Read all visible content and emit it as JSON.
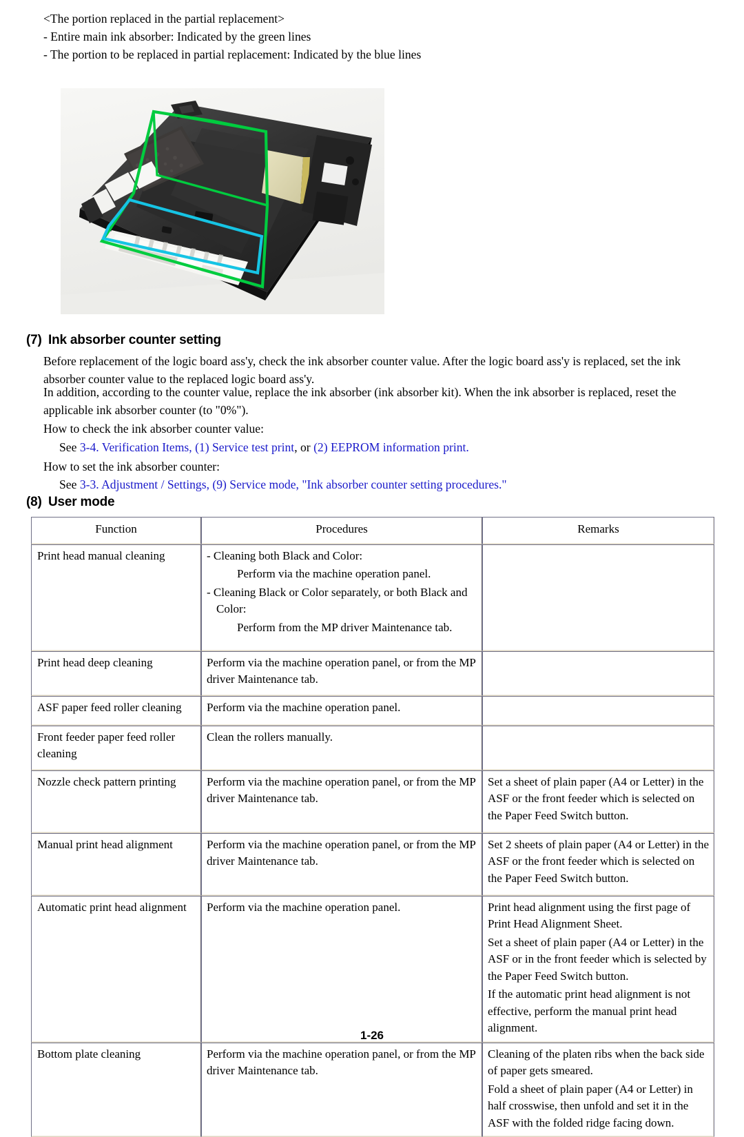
{
  "intro": {
    "title": "<The portion replaced in the partial replacement>",
    "bullet1": "- Entire main ink absorber:  Indicated by the green lines",
    "bullet2": "- The portion to be replaced in partial replacement:  Indicated by the blue lines"
  },
  "photo": {
    "alt": "Printer base frame with main ink absorber areas outlined",
    "green_outline_color": "#00cc3f",
    "blue_outline_color": "#16c4e4",
    "background_color": "#f2f2f0"
  },
  "section7": {
    "number": "(7)",
    "title": "Ink absorber counter setting",
    "para1": "Before replacement of the logic board ass'y, check the ink absorber counter value. After the logic board ass'y is replaced, set the ink absorber counter value to the replaced logic board ass'y.",
    "para2": "In addition, according to the counter value, replace the ink absorber (ink absorber kit). When the ink absorber is replaced, reset the applicable ink absorber counter (to \"0%\").",
    "how_check_label": "How to check the ink absorber counter value:",
    "see1_prefix": "See ",
    "see1_link": "3-4. Verification Items, (1) Service test print",
    "see1_mid": ", or ",
    "see1_link2": "(2) EEPROM information print.",
    "how_set_label": "How to set the ink absorber counter:",
    "see2_prefix": "See ",
    "see2_link": "3-3. Adjustment / Settings, (9) Service mode, \"Ink absorber counter setting procedures.\""
  },
  "section8": {
    "number": "(8)",
    "title": "User mode",
    "table": {
      "headers": [
        "Function",
        "Procedures",
        "Remarks"
      ],
      "rows": [
        {
          "function": "Print head manual cleaning",
          "procedures": [
            {
              "style": "dash",
              "text": "- Cleaning both Black and Color:"
            },
            {
              "style": "ind",
              "text": "Perform via the machine operation panel."
            },
            {
              "style": "dash",
              "text": "- Cleaning Black or Color separately, or both Black and Color:"
            },
            {
              "style": "ind",
              "text": "Perform from the MP driver Maintenance tab."
            }
          ],
          "remarks": []
        },
        {
          "function": "Print head deep cleaning",
          "procedures": [
            {
              "style": "plain",
              "text": "Perform via the machine operation panel, or from the MP driver Maintenance tab."
            }
          ],
          "remarks": []
        },
        {
          "function": "ASF paper feed roller cleaning",
          "procedures": [
            {
              "style": "plain",
              "text": "Perform via the machine operation panel."
            }
          ],
          "remarks": []
        },
        {
          "function": "Front feeder paper feed roller cleaning",
          "procedures": [
            {
              "style": "plain",
              "text": "Clean the rollers manually."
            }
          ],
          "remarks": []
        },
        {
          "function": "Nozzle check pattern printing",
          "procedures": [
            {
              "style": "plain",
              "text": "Perform via the machine operation panel, or from the MP driver Maintenance tab."
            }
          ],
          "remarks": [
            {
              "style": "plain",
              "text": "Set a sheet of plain paper (A4 or Letter) in the ASF or the front feeder which is selected on the Paper Feed Switch button."
            }
          ]
        },
        {
          "function": "Manual print head alignment",
          "procedures": [
            {
              "style": "plain",
              "text": "Perform via the machine operation panel, or from the MP driver Maintenance tab."
            }
          ],
          "remarks": [
            {
              "style": "plain",
              "text": "Set 2 sheets of plain paper (A4 or Letter) in the ASF or the front feeder which is selected on the Paper Feed Switch button."
            }
          ]
        },
        {
          "function": "Automatic print head alignment",
          "procedures": [
            {
              "style": "plain",
              "text": "Perform via the machine operation panel."
            }
          ],
          "remarks": [
            {
              "style": "plain",
              "text": "Print head alignment using the first page of Print Head Alignment Sheet."
            },
            {
              "style": "plain",
              "text": "Set a sheet of plain paper (A4 or Letter) in the ASF or in the front feeder which is selected by the Paper Feed Switch button."
            },
            {
              "style": "plain",
              "text": "If the automatic print head alignment is not effective, perform the manual print head alignment."
            }
          ]
        },
        {
          "function": "Bottom plate cleaning",
          "procedures": [
            {
              "style": "plain",
              "text": "Perform via the machine operation panel, or from the MP driver Maintenance tab."
            }
          ],
          "remarks": [
            {
              "style": "plain",
              "text": "Cleaning of the platen ribs when the back side of paper gets smeared."
            },
            {
              "style": "plain",
              "text": "Fold a sheet of plain paper (A4 or Letter) in half crosswise, then unfold and set it in the ASF with the folded ridge facing down."
            }
          ]
        }
      ]
    }
  },
  "footer": {
    "page_number": "1-26"
  }
}
